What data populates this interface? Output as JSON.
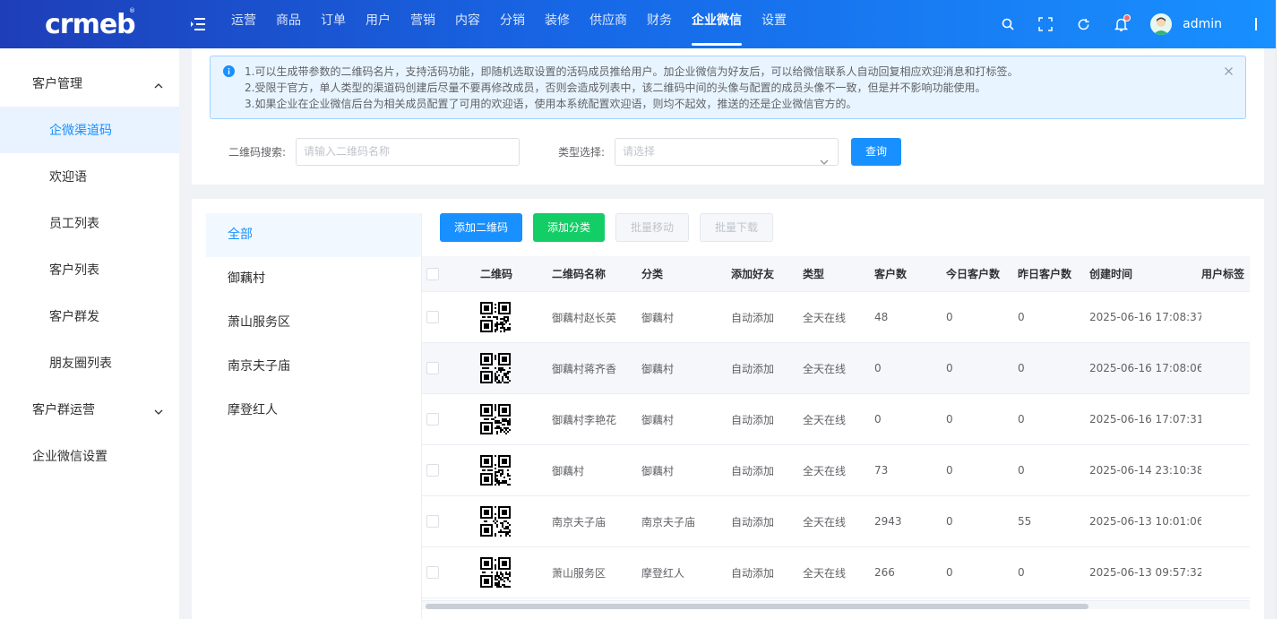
{
  "header": {
    "logo_text": "crmeb",
    "logo_mark": "®",
    "nav_items": [
      "运营",
      "商品",
      "订单",
      "用户",
      "营销",
      "内容",
      "分销",
      "装修",
      "供应商",
      "财务",
      "企业微信",
      "设置"
    ],
    "active_nav_index": 10,
    "username": "admin"
  },
  "sidebar": {
    "groups": [
      {
        "label": "客户管理",
        "expanded": true,
        "items": [
          "企微渠道码",
          "欢迎语",
          "员工列表",
          "客户列表",
          "客户群发",
          "朋友圈列表"
        ]
      },
      {
        "label": "客户群运营",
        "expanded": false,
        "items": []
      },
      {
        "label": "企业微信设置",
        "expanded": false,
        "items": []
      }
    ],
    "active_item": "企微渠道码"
  },
  "alert": {
    "lines": [
      "1.可以生成带参数的二维码名片，支持活码功能，即随机选取设置的活码成员推给用户。加企业微信为好友后，可以给微信联系人自动回复相应欢迎消息和打标签。",
      "2.受限于官方，单人类型的渠道码创建后尽量不要再修改成员，否则会造成列表中，该二维码中间的头像与配置的成员头像不一致，但是并不影响功能使用。",
      "3.如果企业在企业微信后台为相关成员配置了可用的欢迎语，使用本系统配置欢迎语，则均不起效，推送的还是企业微信官方的。"
    ]
  },
  "search": {
    "qr_label": "二维码搜索:",
    "qr_placeholder": "请输入二维码名称",
    "type_label": "类型选择:",
    "type_placeholder": "请选择",
    "query_button": "查询"
  },
  "categories": [
    "全部",
    "御藕村",
    "萧山服务区",
    "南京夫子庙",
    "摩登红人"
  ],
  "active_category": 0,
  "toolbar": {
    "add_qr": "添加二维码",
    "add_category": "添加分类",
    "batch_move": "批量移动",
    "batch_download": "批量下载"
  },
  "table": {
    "columns": [
      "二维码",
      "二维码名称",
      "分类",
      "添加好友",
      "类型",
      "客户数",
      "今日客户数",
      "昨日客户数",
      "创建时间",
      "用户标签"
    ],
    "rows": [
      {
        "name": "御藕村赵长英",
        "category": "御藕村",
        "add_friend": "自动添加",
        "type": "全天在线",
        "customers": "48",
        "today": "0",
        "yesterday": "0",
        "created": "2025-06-16 17:08:37",
        "tags": ""
      },
      {
        "name": "御藕村蒋齐香",
        "category": "御藕村",
        "add_friend": "自动添加",
        "type": "全天在线",
        "customers": "0",
        "today": "0",
        "yesterday": "0",
        "created": "2025-06-16 17:08:06",
        "tags": ""
      },
      {
        "name": "御藕村李艳花",
        "category": "御藕村",
        "add_friend": "自动添加",
        "type": "全天在线",
        "customers": "0",
        "today": "0",
        "yesterday": "0",
        "created": "2025-06-16 17:07:31",
        "tags": ""
      },
      {
        "name": "御藕村",
        "category": "御藕村",
        "add_friend": "自动添加",
        "type": "全天在线",
        "customers": "73",
        "today": "0",
        "yesterday": "0",
        "created": "2025-06-14 23:10:38",
        "tags": ""
      },
      {
        "name": "南京夫子庙",
        "category": "南京夫子庙",
        "add_friend": "自动添加",
        "type": "全天在线",
        "customers": "2943",
        "today": "0",
        "yesterday": "55",
        "created": "2025-06-13 10:01:06",
        "tags": ""
      },
      {
        "name": "萧山服务区",
        "category": "摩登红人",
        "add_friend": "自动添加",
        "type": "全天在线",
        "customers": "266",
        "today": "0",
        "yesterday": "0",
        "created": "2025-06-13 09:57:32",
        "tags": ""
      }
    ],
    "hover_row_index": 1
  },
  "colors": {
    "primary": "#1890ff",
    "success": "#13ce66",
    "header_start": "#1e3eb8",
    "header_end": "#1890ff"
  }
}
